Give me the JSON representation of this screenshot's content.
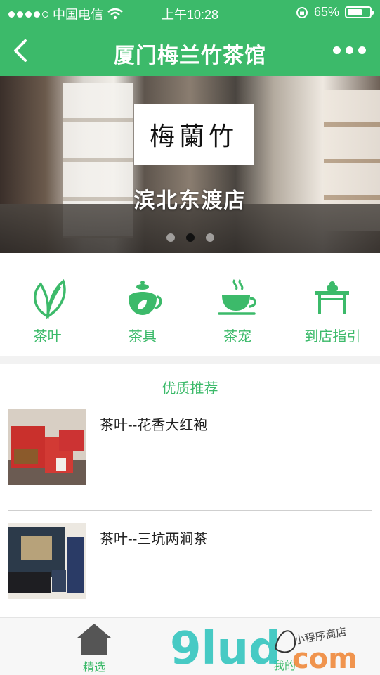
{
  "status": {
    "carrier": "中国电信",
    "time": "上午10:28",
    "battery_text": "65%",
    "battery_level": 0.65
  },
  "nav": {
    "title": "厦门梅兰竹茶馆"
  },
  "banner": {
    "sign_text": "梅蘭竹",
    "subtitle": "滨北东渡店",
    "slides": 3,
    "active_slide": 2
  },
  "categories": [
    {
      "label": "茶叶",
      "icon": "tea-leaf-icon"
    },
    {
      "label": "茶具",
      "icon": "teapot-icon"
    },
    {
      "label": "茶宠",
      "icon": "tea-cup-icon"
    },
    {
      "label": "到店指引",
      "icon": "table-icon"
    }
  ],
  "section": {
    "title": "优质推荐"
  },
  "products": [
    {
      "name": "茶叶--花香大红袍"
    },
    {
      "name": "茶叶--三坑两涧茶"
    }
  ],
  "tabbar": {
    "tabs": [
      {
        "label": "精选"
      },
      {
        "label": "我的"
      }
    ]
  },
  "watermark": {
    "brand": "9lud",
    "suffix": "com",
    "tagline": "小程序商店"
  },
  "colors": {
    "accent": "#3cba6a"
  }
}
